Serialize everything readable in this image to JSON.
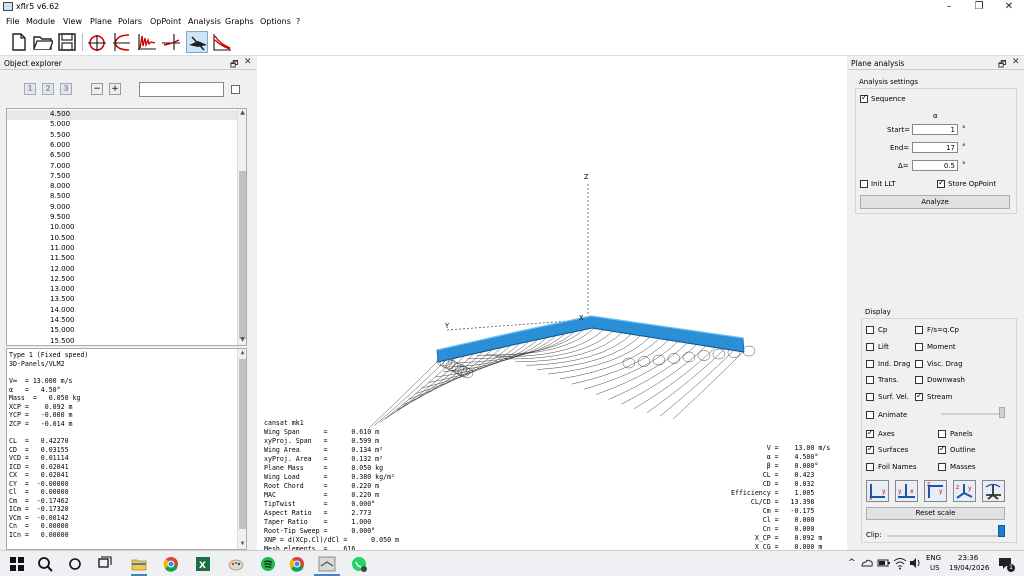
{
  "window": {
    "title": "xflr5 v6.62",
    "minimize": "–",
    "maximize": "❐",
    "close": "✕"
  },
  "menu": [
    "File",
    "Module",
    "View",
    "Plane",
    "Polars",
    "OpPoint",
    "Analysis",
    "Graphs",
    "Options",
    "?"
  ],
  "toolbar": {
    "icons": [
      "new-file-icon",
      "open-folder-icon",
      "save-icon",
      "foil-design-icon",
      "direct-design-icon",
      "xfoil-analysis-icon",
      "inverse-design-icon",
      "wing-plane-design-icon",
      "cp-view-icon"
    ],
    "active_icon": "wing-plane-design-icon"
  },
  "object_explorer": {
    "title": "Object explorer",
    "float": "🗗",
    "close": "✕",
    "level_buttons": [
      "1",
      "2",
      "3"
    ],
    "collapse": "−",
    "expand": "+",
    "filter_value": "",
    "list": [
      "4.500",
      "5.000",
      "5.500",
      "6.000",
      "6.500",
      "7.000",
      "7.500",
      "8.000",
      "8.500",
      "9.000",
      "9.500",
      "10.000",
      "10.500",
      "11.000",
      "11.500",
      "12.000",
      "12.500",
      "13.000",
      "13.500",
      "14.000",
      "14.500",
      "15.000",
      "15.500"
    ],
    "selected": "4.500"
  },
  "results_text": [
    "Type 1 (Fixed speed)",
    "3D-Panels/VLM2",
    "",
    "V∞  = 13.000 m/s",
    "α   =   4.50°",
    "Mass  =   0.050 kg",
    "XCP =    0.092 m",
    "YCP =   -0.000 m",
    "ZCP =   -0.014 m",
    "",
    "CL  =   0.42270",
    "CD  =   0.03155",
    "VCD =   0.01114",
    "ICD =   0.02041",
    "CX  =   0.02041",
    "CY  =  -0.00000",
    "Cl  =   0.00000",
    "Cm  =  -0.17462",
    "ICm =  -0.17320",
    "VCm =  -0.00142",
    "Cn  =   0.00000",
    "ICn =   0.00000"
  ],
  "view3d": {
    "axis_z": "Z",
    "axis_y": "Y",
    "axis_x": "X",
    "plane_info": [
      "cansat mk1",
      "Wing Span      =      0.610 m",
      "xyProj. Span   =      0.599 m",
      "Wing Area      =      0.134 m²",
      "xyProj. Area   =      0.132 m²",
      "Plane Mass     =      0.050 kg",
      "Wing Load      =      0.380 kg/m²",
      "Root Chord     =      0.220 m",
      "MAC            =      0.220 m",
      "TipTwist       =      0.000°",
      "Aspect Ratio   =      2.773",
      "Taper Ratio    =      1.000",
      "Root-Tip Sweep =      0.000°",
      "XNP = d(XCp.Cl)/dCl =      0.050 m",
      "Mesh elements  =    616"
    ],
    "oppoint_info": [
      "         V =    13.00 m/s",
      "         α =    4.500°",
      "         β =    0.000°",
      "        CL =    0.423",
      "        CD =    0.032",
      "Efficiency =    1.005",
      "     CL/CD =   13.398",
      "        Cm =   -0.175",
      "        Cl =    0.000",
      "        Cn =    0.000",
      "      X_CP =    0.092 m",
      "      X_CG =    0.000 m"
    ]
  },
  "plane_analysis": {
    "title": "Plane analysis",
    "float": "🗗",
    "close": "✕",
    "settings_label": "Analysis settings",
    "sequence_label": "Sequence",
    "sequence_checked": true,
    "param_symbol": "α",
    "start_label": "Start=",
    "start_value": "1",
    "end_label": "End=",
    "end_value": "17",
    "delta_label": "Δ=",
    "delta_value": "0.5",
    "unit": "°",
    "init_llt_label": "Init LLT",
    "store_oppoint_label": "Store OpPoint",
    "analyze_label": "Analyze",
    "display_label": "Display",
    "display_left": [
      {
        "label": "Cp",
        "checked": false
      },
      {
        "label": "Lift",
        "checked": false
      },
      {
        "label": "Ind. Drag",
        "checked": false
      },
      {
        "label": "Trans.",
        "checked": false
      },
      {
        "label": "Surf. Vel.",
        "checked": false
      }
    ],
    "display_right": [
      {
        "label": "F/s=q.Cp",
        "checked": false
      },
      {
        "label": "Moment",
        "checked": false
      },
      {
        "label": "Visc. Drag",
        "checked": false
      },
      {
        "label": "Downwash",
        "checked": false
      },
      {
        "label": "Stream",
        "checked": true
      }
    ],
    "animate_label": "Animate",
    "axes_label": "Axes",
    "panels_label": "Panels",
    "surfaces_label": "Surfaces",
    "outline_label": "Outline",
    "foil_names_label": "Foil Names",
    "masses_label": "Masses",
    "reset_scale_label": "Reset scale",
    "clip_label": "Clip:"
  },
  "taskbar": {
    "lang": "ENG",
    "region": "US",
    "time": "23:36",
    "date": "19/04/2026",
    "notifications": "1",
    "chevron": "^"
  },
  "colors": {
    "wing": "#2a8fd6",
    "accent": "#4a7fc1"
  }
}
